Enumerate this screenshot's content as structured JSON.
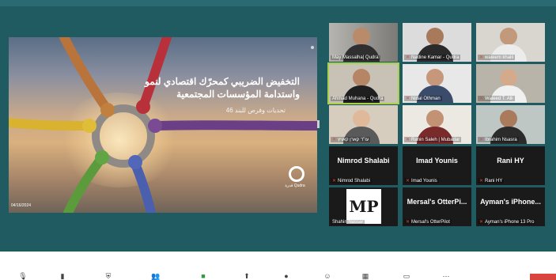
{
  "slide": {
    "title": "التخفيض الضريبي كمحرّك اقتصادي لنمو واستدامة المؤسسات المجتمعية",
    "subtitle": "تحديات وفرص للبند 46",
    "date": "04/16/2024",
    "logo_text": "قدرة Qudra"
  },
  "participants": [
    {
      "name": "May Massalha| Qudra",
      "muted": false,
      "kind": "video"
    },
    {
      "name": "Nadine Kamar - Qudra",
      "muted": true,
      "kind": "video"
    },
    {
      "name": "waleem khalil",
      "muted": true,
      "kind": "video"
    },
    {
      "name": "Ahmad Muhana - Qudra",
      "muted": false,
      "kind": "video",
      "active": true
    },
    {
      "name": "Nidal Othman",
      "muted": true,
      "kind": "video"
    },
    {
      "name": "Waleed T. Alli",
      "muted": true,
      "kind": "video"
    },
    {
      "name": "עו\"ד קארן קאויץ",
      "muted": true,
      "kind": "video"
    },
    {
      "name": "Ranin Saleh | Mubadar",
      "muted": true,
      "kind": "video"
    },
    {
      "name": "Ibrahim Nsasra",
      "muted": true,
      "kind": "video"
    },
    {
      "name": "Nimrod Shalabi",
      "big": "Nimrod Shalabi",
      "muted": true,
      "kind": "name"
    },
    {
      "name": "Imad Younis",
      "big": "Imad Younis",
      "muted": true,
      "kind": "name"
    },
    {
      "name": "Rani HY",
      "big": "Rani HY",
      "muted": true,
      "kind": "name"
    },
    {
      "name": "Shahin Nassar",
      "muted": false,
      "kind": "logo",
      "logo": "MP"
    },
    {
      "name": "Mersal's OtterPilot",
      "big": "Mersal's OtterPi...",
      "muted": true,
      "kind": "name"
    },
    {
      "name": "Ayman's iPhone 13 Pro",
      "big": "Ayman's iPhone...",
      "muted": true,
      "kind": "name"
    }
  ],
  "toolbar": {
    "icons": [
      "mic-icon",
      "video-icon",
      "security-icon",
      "participants-icon",
      "chat-icon",
      "share-icon",
      "record-icon",
      "reactions-icon",
      "apps-icon",
      "whiteboard-icon",
      "more-icon"
    ]
  }
}
